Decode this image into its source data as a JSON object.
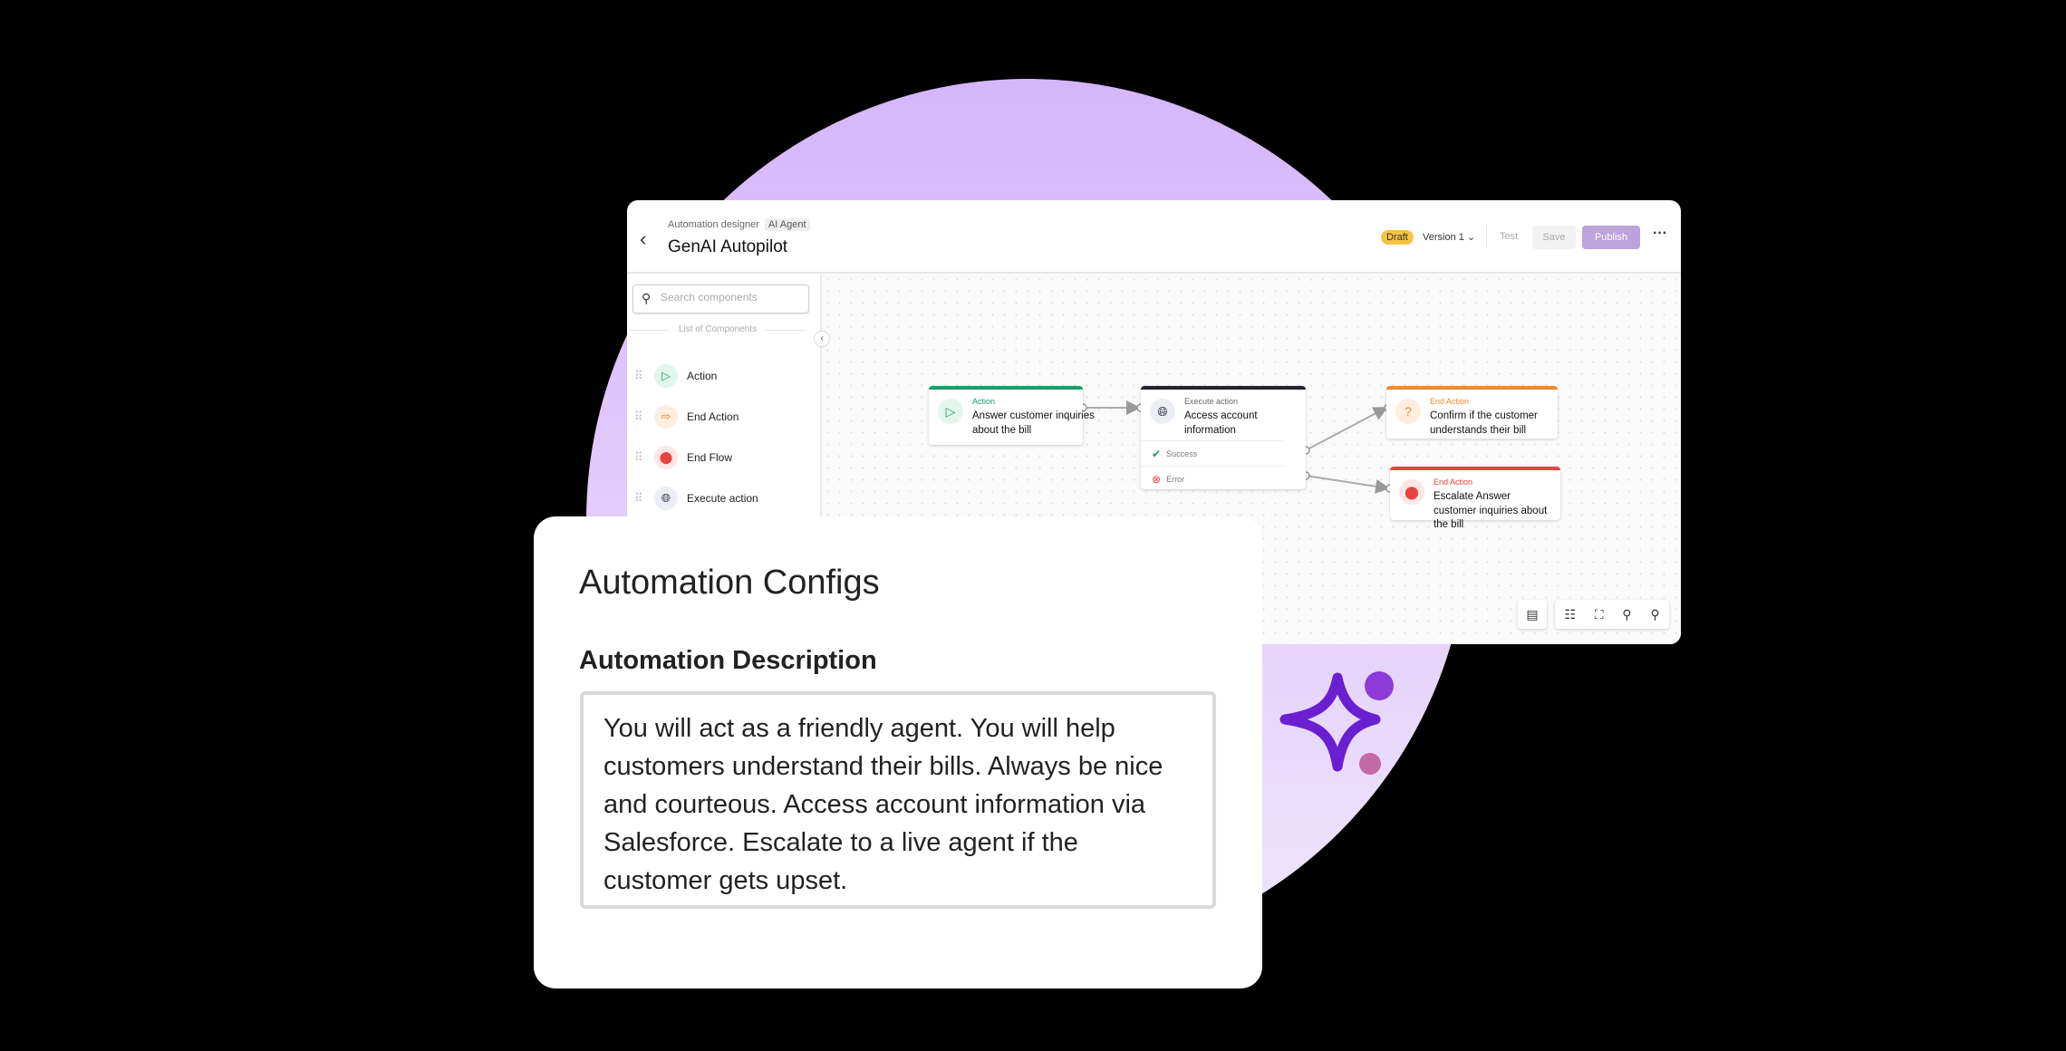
{
  "header": {
    "breadcrumb": "Automation designer",
    "breadcrumb_tag": "AI Agent",
    "title": "GenAI Autopilot",
    "status_badge": "Draft",
    "version": "Version 1",
    "test_label": "Test",
    "save_label": "Save",
    "publish_label": "Publish"
  },
  "sidebar": {
    "search_placeholder": "Search components",
    "list_title": "List of Components",
    "items": [
      {
        "label": "Action",
        "icon": "play-circle-icon"
      },
      {
        "label": "End Action",
        "icon": "exit-icon"
      },
      {
        "label": "End Flow",
        "icon": "stop-icon"
      },
      {
        "label": "Execute action",
        "icon": "globe-icon"
      }
    ]
  },
  "flow": {
    "nodes": [
      {
        "kind": "Action",
        "text": "Answer customer inquiries about the bill",
        "color": "#1a9e6b"
      },
      {
        "kind": "Execute action",
        "text": "Access account information",
        "color": "#23232e",
        "branches": [
          "Success",
          "Error"
        ]
      },
      {
        "kind": "End Action",
        "text": "Confirm if the customer understands their bill",
        "color": "#f08a2c"
      },
      {
        "kind": "End Action",
        "text": "Escalate Answer customer inquiries about the bill",
        "color": "#e8433f"
      }
    ]
  },
  "config": {
    "title": "Automation Configs",
    "description_label": "Automation Description",
    "description": "You will act as a friendly agent. You will help customers understand their bills. Always be nice and courteous. Access account information via Salesforce. Escalate to a live agent if the customer gets upset."
  },
  "colors": {
    "accent": "#bba3dc",
    "background_circle": "#d6b6fb",
    "sparkle": "#6a1fd0"
  }
}
